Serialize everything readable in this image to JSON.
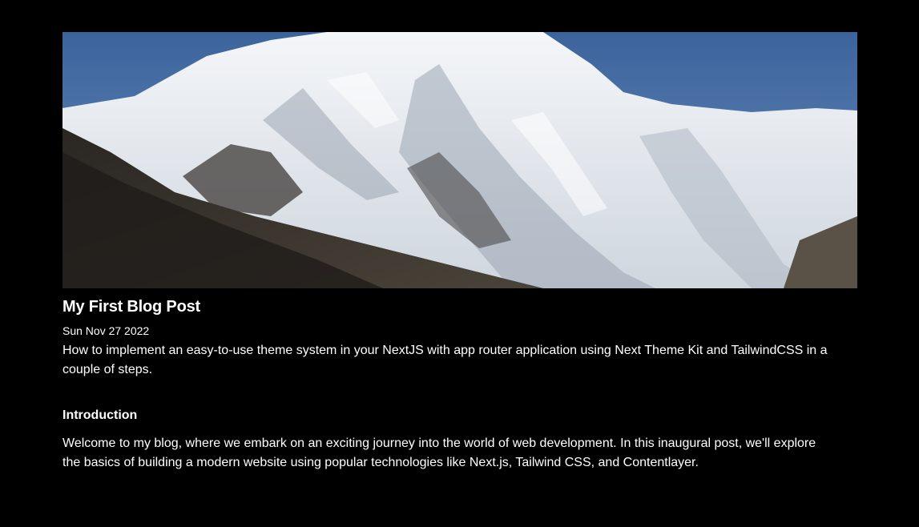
{
  "post": {
    "cover_image": "snowy-mountain-peak-photo",
    "title": "My First Blog Post",
    "date": "Sun Nov 27 2022",
    "summary": "How to implement an easy-to-use theme system in your NextJS with app router application using Next Theme Kit and TailwindCSS in a couple of steps.",
    "section_heading": "Introduction",
    "body": "Welcome to my blog, where we embark on an exciting journey into the world of web development. In this inaugural post, we'll explore the basics of building a modern website using popular technologies like Next.js, Tailwind CSS, and Contentlayer."
  },
  "colors": {
    "background": "#000000",
    "text": "#ffffff"
  }
}
